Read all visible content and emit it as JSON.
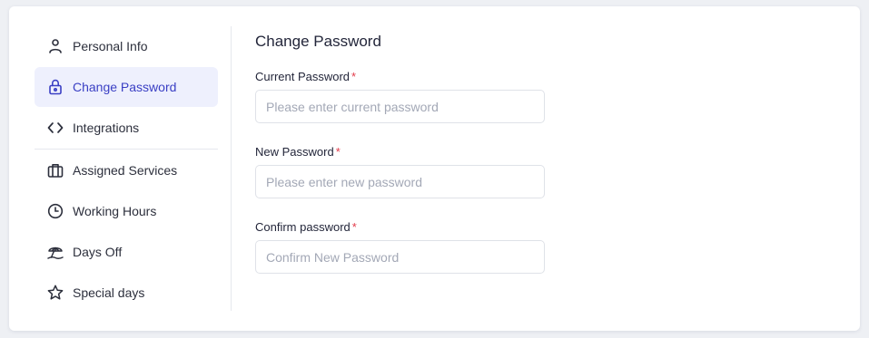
{
  "sidebar": {
    "items": [
      {
        "label": "Personal Info",
        "icon": "user-icon",
        "active": false
      },
      {
        "label": "Change Password",
        "icon": "lock-icon",
        "active": true
      },
      {
        "label": "Integrations",
        "icon": "code-icon",
        "active": false
      },
      {
        "label": "Assigned Services",
        "icon": "briefcase-icon",
        "active": false
      },
      {
        "label": "Working Hours",
        "icon": "clock-icon",
        "active": false
      },
      {
        "label": "Days Off",
        "icon": "beach-umbrella-icon",
        "active": false
      },
      {
        "label": "Special days",
        "icon": "star-icon",
        "active": false
      }
    ]
  },
  "form": {
    "title": "Change Password",
    "current_password": {
      "label": "Current Password",
      "required_mark": "*",
      "placeholder": "Please enter current password",
      "value": ""
    },
    "new_password": {
      "label": "New Password",
      "required_mark": "*",
      "placeholder": "Please enter new password",
      "value": ""
    },
    "confirm_password": {
      "label": "Confirm password",
      "required_mark": "*",
      "placeholder": "Confirm New Password",
      "value": ""
    }
  },
  "colors": {
    "accent": "#3a3fc4",
    "active_bg": "#eef0fd",
    "required": "#e23b4a",
    "text": "#2c2f3c",
    "border": "#dfe2e8"
  }
}
